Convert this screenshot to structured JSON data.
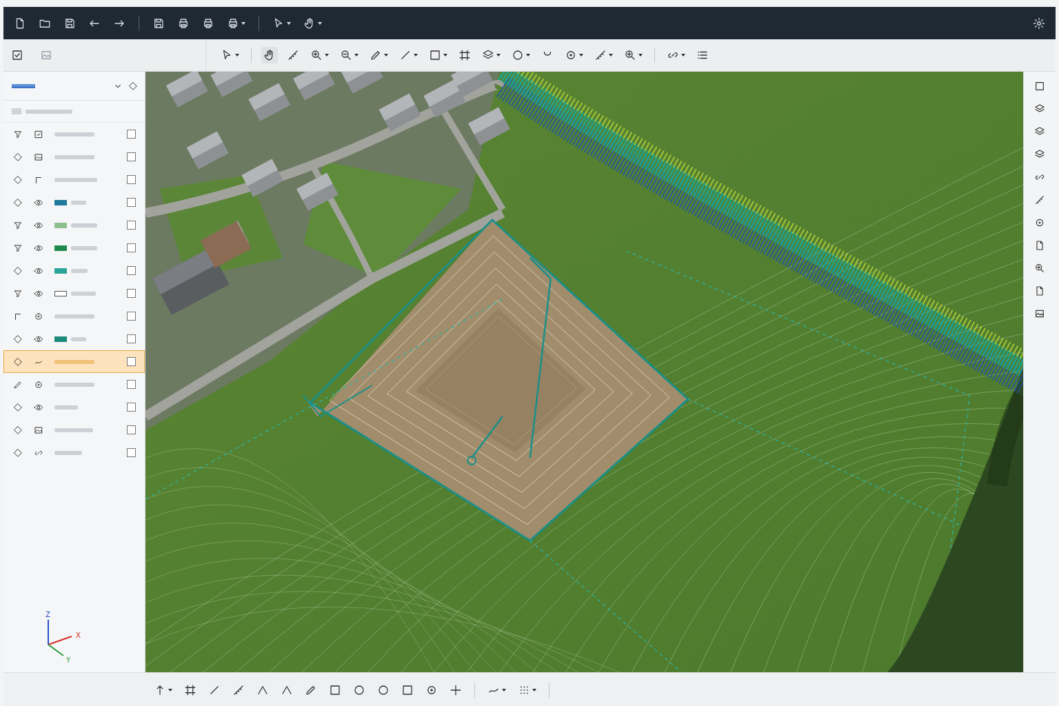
{
  "layers": [
    {
      "kind": "plain",
      "visible": false,
      "checked": false,
      "selected": false
    },
    {
      "kind": "plain",
      "visible": false,
      "checked": false,
      "selected": false
    },
    {
      "kind": "plain",
      "visible": false,
      "checked": false,
      "selected": false
    },
    {
      "kind": "swatch",
      "visible": true,
      "checked": false,
      "selected": false,
      "color": "#1f7a9c"
    },
    {
      "kind": "swatch",
      "visible": true,
      "checked": false,
      "selected": false,
      "color": "#8fbf8f"
    },
    {
      "kind": "swatch",
      "visible": true,
      "checked": false,
      "selected": false,
      "color": "#1e8a4a"
    },
    {
      "kind": "swatch",
      "visible": true,
      "checked": false,
      "selected": false,
      "color": "#2aa59a"
    },
    {
      "kind": "outline",
      "visible": true,
      "checked": false,
      "selected": false
    },
    {
      "kind": "plain",
      "visible": false,
      "checked": false,
      "selected": false
    },
    {
      "kind": "swatch",
      "visible": true,
      "checked": false,
      "selected": false,
      "color": "#1a8a7a"
    },
    {
      "kind": "plain",
      "visible": false,
      "checked": false,
      "selected": true
    },
    {
      "kind": "plain",
      "visible": false,
      "checked": false,
      "selected": false
    },
    {
      "kind": "plain",
      "visible": true,
      "checked": false,
      "selected": false
    },
    {
      "kind": "plain",
      "visible": false,
      "checked": false,
      "selected": false
    },
    {
      "kind": "plain",
      "visible": false,
      "checked": false,
      "selected": false
    }
  ],
  "axes": [
    {
      "label": "Z",
      "color": "#2a4fd0"
    },
    {
      "label": "X",
      "color": "#d0302a"
    },
    {
      "label": "Y",
      "color": "#2a9a3a"
    }
  ]
}
